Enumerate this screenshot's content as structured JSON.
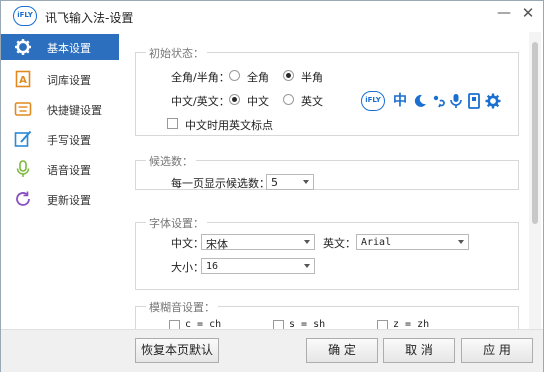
{
  "window": {
    "title": "讯飞输入法-设置",
    "logo_text": "iFLY",
    "minimize": "—",
    "close": "✕"
  },
  "sidebar": {
    "items": [
      {
        "label": "基本设置",
        "icon": "gear-icon",
        "active": true
      },
      {
        "label": "词库设置",
        "icon": "dictionary-icon",
        "active": false
      },
      {
        "label": "快捷键设置",
        "icon": "keyboard-icon",
        "active": false
      },
      {
        "label": "手写设置",
        "icon": "pen-icon",
        "active": false
      },
      {
        "label": "语音设置",
        "icon": "microphone-icon",
        "active": false
      },
      {
        "label": "更新设置",
        "icon": "refresh-icon",
        "active": false
      }
    ]
  },
  "initial_state": {
    "title": "初始状态：",
    "width_label": "全角/半角：",
    "full_width": "全角",
    "half_width": "半角",
    "lang_label": "中文/英文：",
    "chinese": "中文",
    "english": "英文",
    "punct_checkbox": "中文时用英文标点",
    "selected_width": "半角",
    "selected_lang": "中文",
    "punct_checked": false
  },
  "toolbar_preview": {
    "logo_text": "iFLY",
    "mode_char": "中",
    "icons": [
      "moon-icon",
      "punctuation-icon",
      "microphone-icon",
      "keyboard-icon",
      "gear-icon"
    ]
  },
  "candidates": {
    "title": "候选数：",
    "label": "每一页显示候选数：",
    "value": "5"
  },
  "font": {
    "title": "字体设置：",
    "cn_label": "中文：",
    "cn_value": "宋体",
    "en_label": "英文：",
    "en_value": "Arial",
    "size_label": "大小：",
    "size_value": "16"
  },
  "fuzzy": {
    "title": "模糊音设置：",
    "items": [
      "c = ch",
      "s = sh",
      "z = zh"
    ]
  },
  "footer": {
    "restore": "恢复本页默认",
    "ok": "确 定",
    "cancel": "取 消",
    "apply": "应 用"
  },
  "colors": {
    "accent": "#2d6fbf",
    "brand": "#1a6fd1"
  }
}
